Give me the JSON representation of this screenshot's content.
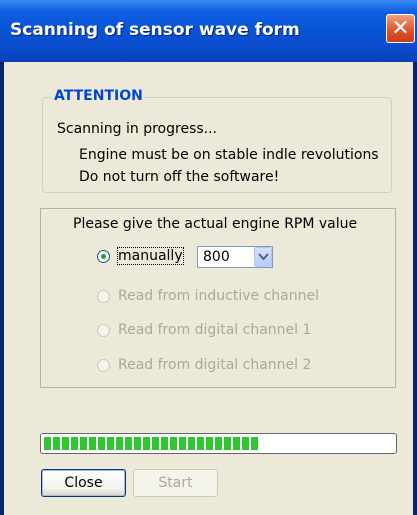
{
  "window": {
    "title": "Scanning of sensor wave form",
    "close_glyph": "✕"
  },
  "attention": {
    "title": "ATTENTION",
    "line1": "Scanning in progress...",
    "line2": "Engine must be on stable indle revolutions",
    "line3": "Do not turn off the software!"
  },
  "rpm": {
    "prompt": "Please give the actual engine RPM value",
    "options": [
      {
        "label": "manually",
        "selected": true,
        "enabled": true
      },
      {
        "label": "Read from inductive channel",
        "selected": false,
        "enabled": false
      },
      {
        "label": "Read from digital channel 1",
        "selected": false,
        "enabled": false
      },
      {
        "label": "Read from digital channel 2",
        "selected": false,
        "enabled": false
      }
    ],
    "manual_value": "800"
  },
  "progress": {
    "fraction": 0.62
  },
  "buttons": {
    "close": "Close",
    "start": "Start"
  },
  "colors": {
    "accent": "#0046d5",
    "progress": "#2ec82e",
    "titlebar": "#0853d6"
  }
}
